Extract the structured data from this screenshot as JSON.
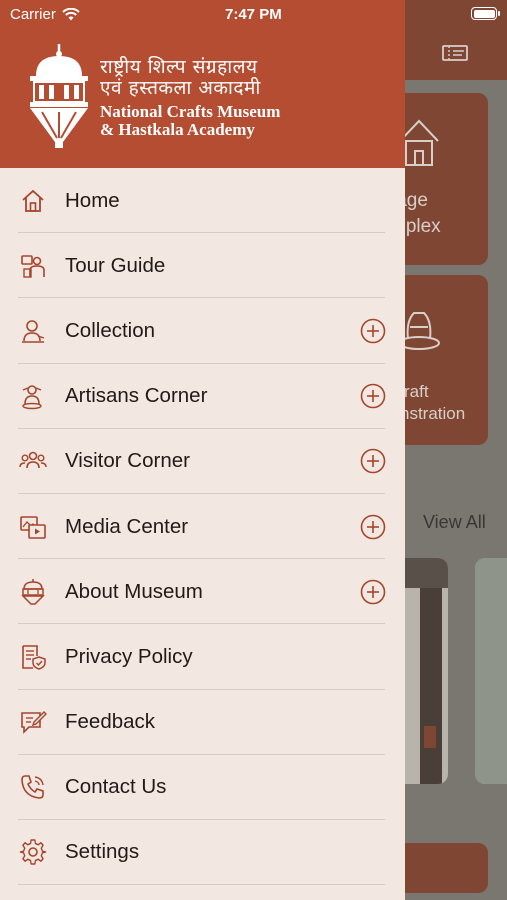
{
  "status_bar": {
    "carrier": "Carrier",
    "time": "7:47 PM"
  },
  "drawer": {
    "brand": {
      "hindi_line1": "राष्ट्रीय शिल्प संग्रहालय",
      "hindi_line2": "एवं हस्तकला अकादमी",
      "english_line1": "National Crafts Museum",
      "english_line2": "& Hastkala Academy"
    },
    "menu": [
      {
        "label": "Home",
        "icon": "home-icon",
        "expandable": false
      },
      {
        "label": "Tour Guide",
        "icon": "tour-guide-icon",
        "expandable": false
      },
      {
        "label": "Collection",
        "icon": "collection-icon",
        "expandable": true
      },
      {
        "label": "Artisans Corner",
        "icon": "artisan-icon",
        "expandable": true
      },
      {
        "label": "Visitor Corner",
        "icon": "visitors-icon",
        "expandable": true
      },
      {
        "label": "Media Center",
        "icon": "media-icon",
        "expandable": true
      },
      {
        "label": "About Museum",
        "icon": "museum-icon",
        "expandable": true
      },
      {
        "label": "Privacy Policy",
        "icon": "privacy-icon",
        "expandable": false
      },
      {
        "label": "Feedback",
        "icon": "feedback-icon",
        "expandable": false
      },
      {
        "label": "Contact Us",
        "icon": "phone-icon",
        "expandable": false
      },
      {
        "label": "Settings",
        "icon": "gear-icon",
        "expandable": false
      }
    ]
  },
  "background": {
    "card1_line1": "lage",
    "card1_line2": "mplex",
    "card2_line1": "raft",
    "card2_line2": "nstration",
    "view_all": "View All"
  },
  "colors": {
    "accent": "#b44d32",
    "drawer_bg": "#f2e8e1",
    "icon": "#a5452d"
  }
}
